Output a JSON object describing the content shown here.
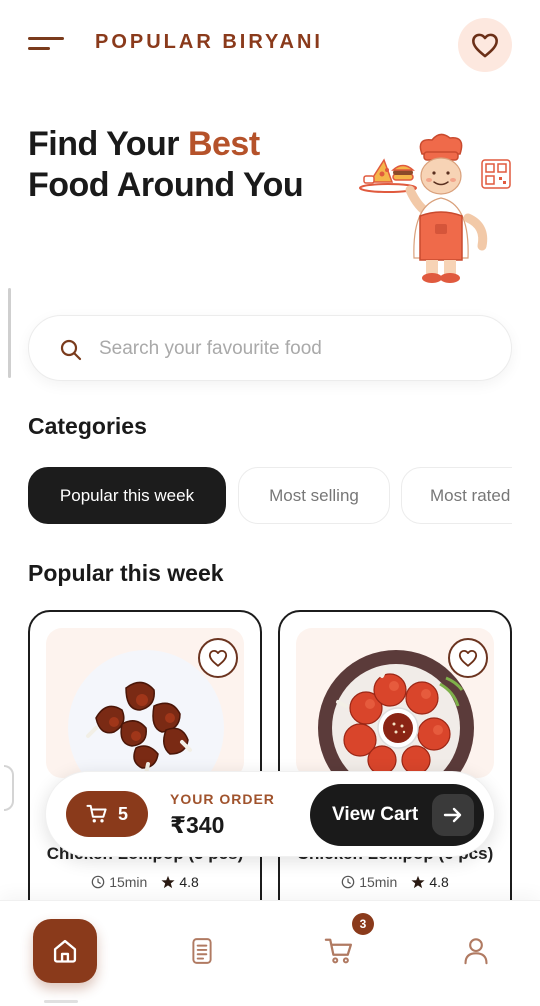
{
  "header": {
    "brand": "POPULAR BIRYANI",
    "menu_icon": "hamburger-menu-icon",
    "favorite_icon": "heart-icon"
  },
  "hero": {
    "title_before": "Find Your ",
    "title_accent": "Best",
    "title_after": "Food Around You",
    "illustration": "chef-holding-food-tray"
  },
  "search": {
    "icon": "search-icon",
    "placeholder": "Search your favourite food",
    "value": ""
  },
  "categories": {
    "title": "Categories",
    "items": [
      {
        "label": "Popular this week",
        "active": true
      },
      {
        "label": "Most selling",
        "active": false
      },
      {
        "label": "Most rated",
        "active": false
      }
    ]
  },
  "popular": {
    "title": "Popular this week",
    "items": [
      {
        "name": "Chicken Lollipop (5 pcs)",
        "time": "15min",
        "rating": "4.8"
      },
      {
        "name": "Chicken Lollipop (6 pcs)",
        "time": "15min",
        "rating": "4.8"
      }
    ]
  },
  "order_bar": {
    "cart_count": "5",
    "label": "YOUR ORDER",
    "total": "₹340",
    "view_cart": "View Cart"
  },
  "bottom_nav": {
    "items": [
      "home-icon",
      "orders-icon",
      "cart-icon",
      "profile-icon"
    ],
    "cart_badge": "3"
  },
  "colors": {
    "brand": "#8a3a1b",
    "accent": "#b5522a",
    "dark": "#1c1c1c",
    "chef_apron": "#ef6a4a"
  }
}
